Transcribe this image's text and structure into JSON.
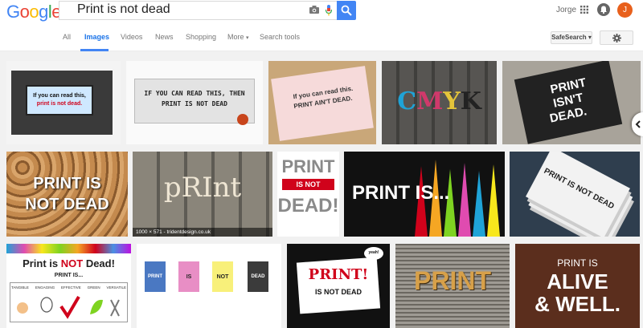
{
  "logo": {
    "letters": [
      "G",
      "o",
      "o",
      "g",
      "l",
      "e"
    ],
    "colors": [
      "#4285f4",
      "#ea4335",
      "#fbbc05",
      "#4285f4",
      "#34a853",
      "#ea4335"
    ]
  },
  "search": {
    "query": "Print is not dead"
  },
  "user": {
    "name": "Jorge",
    "initial": "J"
  },
  "nav": {
    "tabs": [
      "All",
      "Images",
      "Videos",
      "News",
      "Shopping",
      "More",
      "Search tools"
    ],
    "active": "Images",
    "more_arrow": "▾",
    "safesearch": "SafeSearch ▾"
  },
  "images": {
    "r1": {
      "billboard": {
        "line1": "If you can read this,",
        "line2": "print is not dead."
      },
      "sign": {
        "line1": "IF YOU CAN READ THIS, THEN",
        "line2": "PRINT IS NOT DEAD"
      },
      "poster": {
        "line1": "If you can read this.",
        "line2": "PRINT AIN'T DEAD."
      },
      "cmyk": {
        "text": "CMYK"
      },
      "isnt": {
        "line1": "PRINT",
        "line2": "ISN'T",
        "line3": "DEAD."
      }
    },
    "r2": {
      "wood": {
        "line1": "PRINT IS",
        "line2": "NOT DEAD"
      },
      "letterpress": {
        "text": "pRInt",
        "caption": "1000 × 571 - tridentdesign.co.uk"
      },
      "badge": {
        "line1": "PRINT",
        "line2": "IS NOT",
        "line3": "DEAD!"
      },
      "spikes": {
        "text": "PRINT IS..."
      },
      "stack": {
        "text": "PRINT IS NOT DEAD"
      }
    },
    "r3": {
      "notdead": {
        "title_a": "Print is ",
        "title_b": "NOT",
        "title_c": " Dead!",
        "sub": "PRINT IS...",
        "labels": [
          "TANGIBLE",
          "ENGAGING",
          "EFFECTIVE",
          "GREEN",
          "VERSATILE"
        ]
      },
      "cards": {
        "words": [
          "PRINT",
          "IS",
          "NOT",
          "DEAD"
        ]
      },
      "punk": {
        "line1": "PRINT!",
        "line2": "IS NOT DEAD",
        "bubble": "yeah!"
      },
      "type": {
        "text": "PRINT"
      },
      "alive": {
        "line1": "PRINT IS",
        "line2": "ALIVE",
        "line3": "& WELL."
      }
    }
  }
}
